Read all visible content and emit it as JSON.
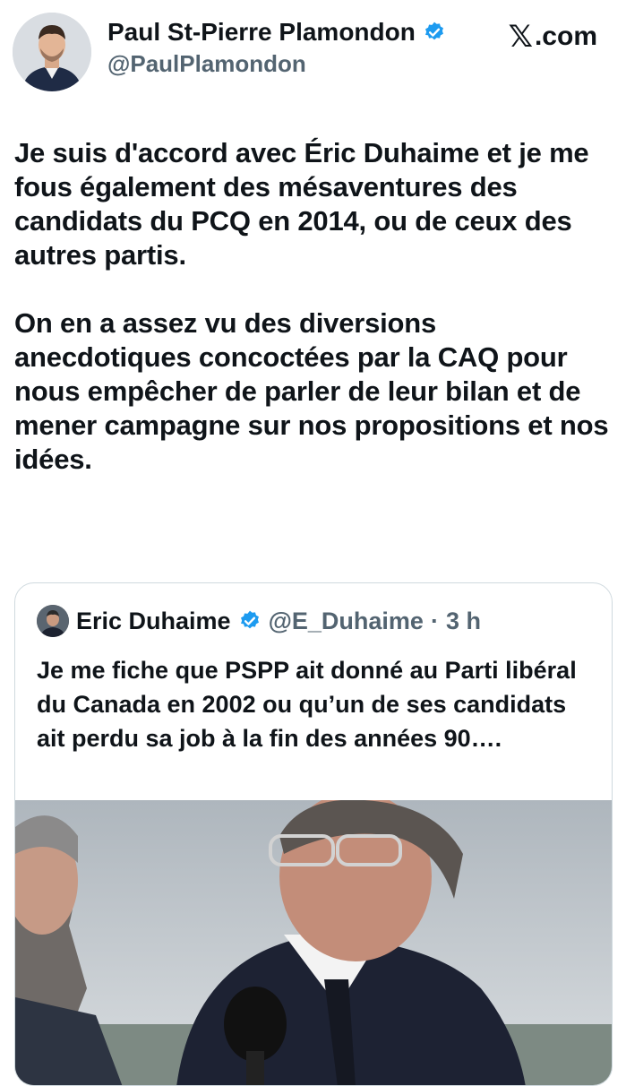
{
  "author": {
    "display_name": "Paul St-Pierre Plamondon",
    "handle": "@PaulPlamondon",
    "verified": true,
    "avatar_icon": "profile-photo"
  },
  "brand": {
    "logo_icon": "x-logo",
    "site": ".com"
  },
  "tweet": {
    "paragraphs": [
      "Je suis d'accord avec Éric Duhaime et je me fous également des mésaventures des candidats du PCQ en 2014, ou de ceux des autres partis.",
      "On en a assez vu des diversions anecdotiques concoctées par la CAQ pour nous empêcher de parler de leur bilan et de mener campagne sur nos propositions et nos idées."
    ]
  },
  "quoted_tweet": {
    "display_name": "Eric Duhaime",
    "verified": true,
    "handle": "@E_Duhaime",
    "separator": "·",
    "time": "3 h",
    "text": "Je me fiche que PSPP ait donné au Parti libéral du Canada en 2002 ou qu’un de ses candidats ait perdu sa job à la fin des années 90….",
    "media_icon": "video-thumbnail"
  },
  "colors": {
    "verified_blue": "#1d9bf0",
    "secondary_text": "#536471",
    "border": "#cfd9de"
  }
}
